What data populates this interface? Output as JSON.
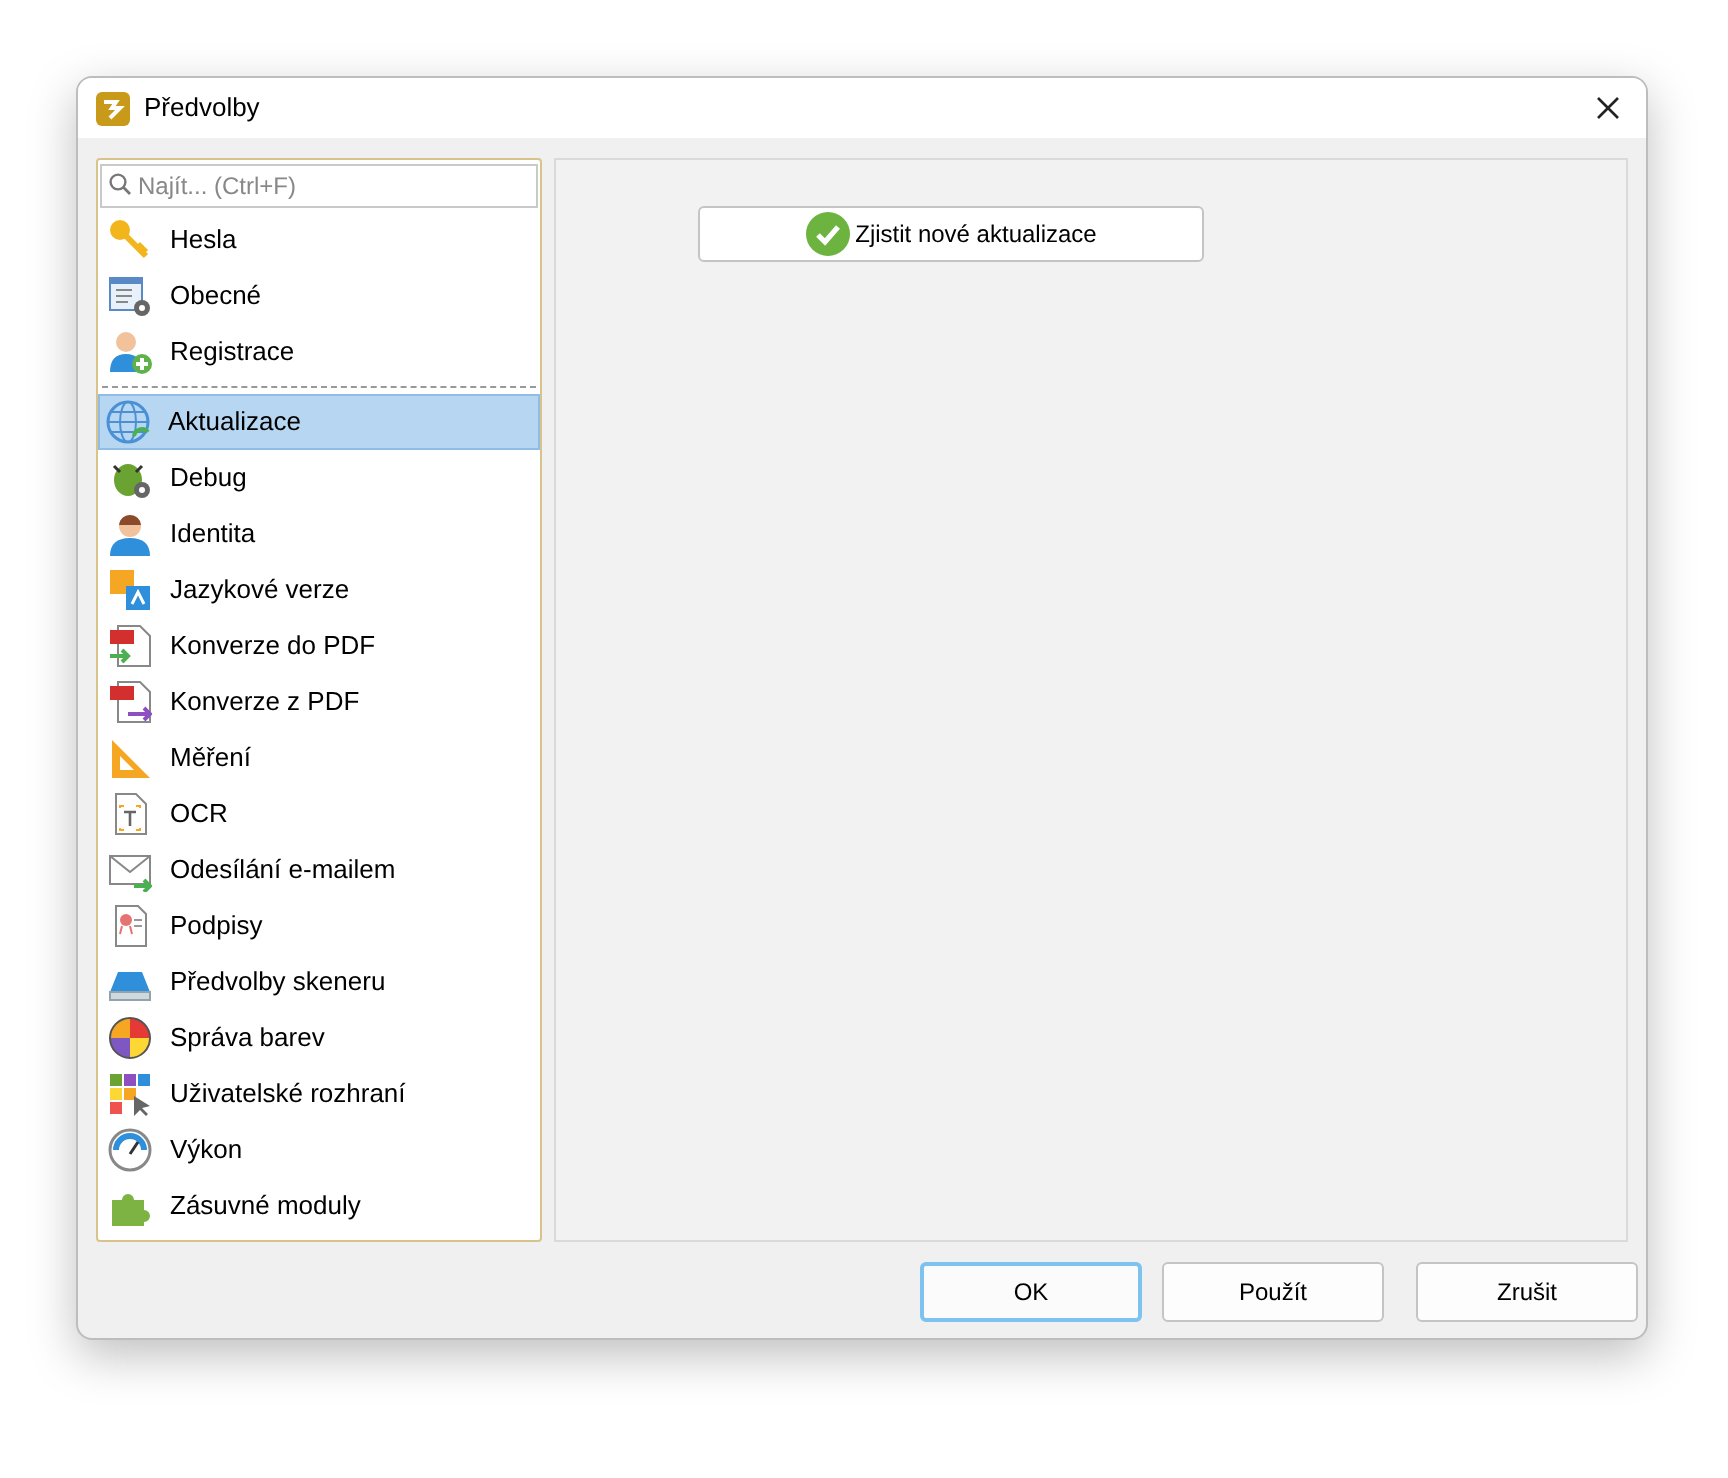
{
  "window": {
    "title": "Předvolby"
  },
  "sidebar": {
    "search": {
      "placeholder": "Najít... (Ctrl+F)"
    },
    "groups": [
      {
        "items": [
          {
            "label": "Hesla",
            "selected": false
          },
          {
            "label": "Obecné",
            "selected": false
          },
          {
            "label": "Registrace",
            "selected": false
          }
        ]
      },
      {
        "items": [
          {
            "label": "Aktualizace",
            "selected": true
          },
          {
            "label": "Debug",
            "selected": false
          },
          {
            "label": "Identita",
            "selected": false
          },
          {
            "label": "Jazykové verze",
            "selected": false
          },
          {
            "label": "Konverze do PDF",
            "selected": false
          },
          {
            "label": "Konverze z PDF",
            "selected": false
          },
          {
            "label": "Měření",
            "selected": false
          },
          {
            "label": "OCR",
            "selected": false
          },
          {
            "label": "Odesílání e-mailem",
            "selected": false
          },
          {
            "label": "Podpisy",
            "selected": false
          },
          {
            "label": "Předvolby skeneru",
            "selected": false
          },
          {
            "label": "Správa barev",
            "selected": false
          },
          {
            "label": "Uživatelské rozhraní",
            "selected": false
          },
          {
            "label": "Výkon",
            "selected": false
          },
          {
            "label": "Zásuvné moduly",
            "selected": false
          }
        ]
      }
    ]
  },
  "content": {
    "button": "Zjistit nové aktualizace"
  },
  "buttons": [
    {
      "label": "OK",
      "default": true
    },
    {
      "label": "Použít",
      "default": false
    },
    {
      "label": "Zrušit",
      "default": false
    }
  ]
}
